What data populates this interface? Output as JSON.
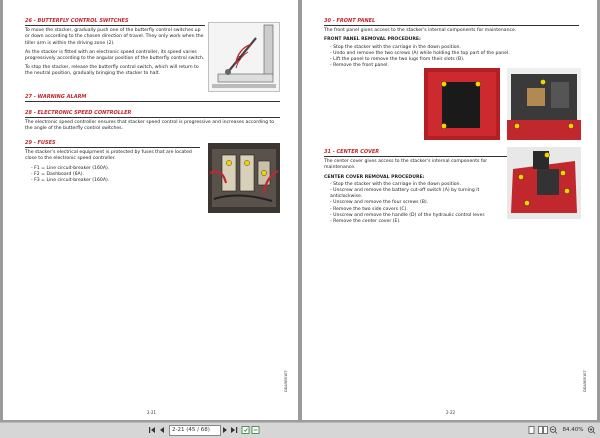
{
  "left_page": {
    "side_code": "DDA5B51E7",
    "page_number": "2-21",
    "s26": {
      "title": "26 - BUTTERFLY CONTROL SWITCHES",
      "p1": "To move the stacker, gradually push one of the butterfly control switches up or down according to the chosen direction of travel. They only work when the tiller arm is within the driving zone (2).",
      "p2": "As the stacker is fitted with an electronic speed controller, its speed varies progressively according to the angular position of the butterfly control switch.",
      "p3": "To stop the stacker, release the butterfly control switch, which will return to the neutral position, gradually bringing the stacker to halt."
    },
    "s27": {
      "title": "27 - WARNING ALARM"
    },
    "s28": {
      "title": "28 - ELECTRONIC SPEED CONTROLLER",
      "p1": "The electronic speed controller ensures that stacker speed control is progressive and increases according to the angle of the butterfly control switches."
    },
    "s29": {
      "title": "29 - FUSES",
      "p1": "The stacker's electrical equipment is protected by fuses that are located close to the electronic speed controller.",
      "items": [
        "- F1 = Line circuit-breaker (160A).",
        "- F2 = Dashboard (6A).",
        "- F3 = Line circuit-breaker (160A)."
      ]
    }
  },
  "right_page": {
    "side_code": "DDA5B51E7",
    "page_number": "2-22",
    "s30": {
      "title": "30 - FRONT PANEL",
      "p1": "The front panel gives access to the stacker's internal components for maintenance.",
      "subhead": "FRONT PANEL REMOVAL PROCEDURE:",
      "items": [
        "- Stop the stacker with the carriage in the down position.",
        "- Undo and remove the two screws (A) while holding the top part of the panel.",
        "- Lift the panel to remove the two lugs from their slots (B).",
        "- Remove the front panel."
      ]
    },
    "s31": {
      "title": "31 - CENTER COVER",
      "p1": "The center cover gives access to the stacker's internal components for maintenance.",
      "subhead": "CENTER COVER REMOVAL PROCEDURE:",
      "items": [
        "- Stop the stacker with the carriage in the down position.",
        "- Unscrew and remove the battery cut-off switch (A) by turning it anticlockwise.",
        "- Unscrew and remove the four screws (B).",
        "- Remove the two side covers (C).",
        "- Unscrew and remove the handle (D) of the hydraulic control lever.",
        "- Remove the center cover (E)."
      ]
    }
  },
  "toolbar": {
    "page_field": "2-21 (45 / 68)",
    "zoom": "84.40%"
  },
  "colors": {
    "accent": "#c0282d",
    "toolbar": "#d6d6d6",
    "background": "#9b9b9b"
  }
}
